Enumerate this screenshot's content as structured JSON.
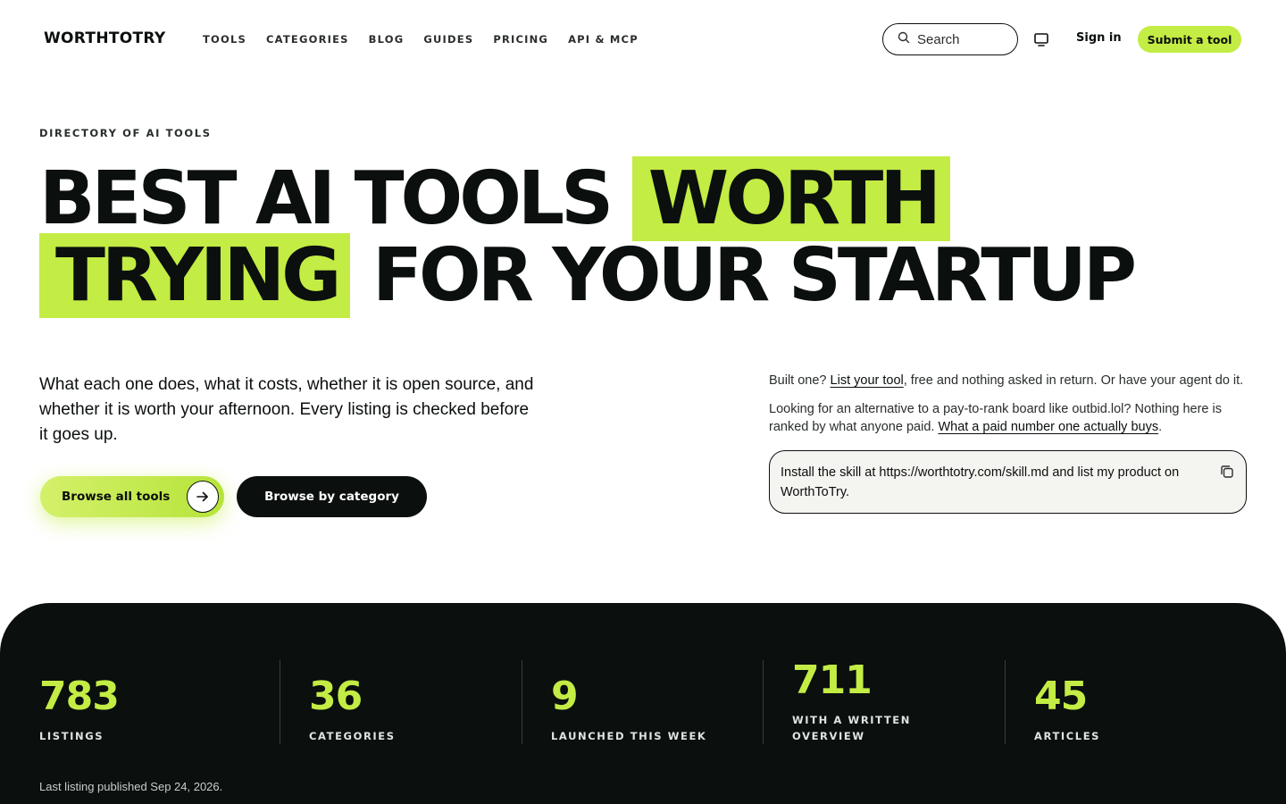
{
  "nav": {
    "logo": "WORTHTOTRY",
    "links": [
      "TOOLS",
      "CATEGORIES",
      "BLOG",
      "GUIDES",
      "PRICING",
      "API & MCP"
    ],
    "search_placeholder": "Search",
    "signin": "Sign in",
    "submit": "Submit a tool"
  },
  "hero": {
    "eyebrow": "DIRECTORY OF AI TOOLS",
    "headline": {
      "line1_plain": "BEST AI TOOLS ",
      "line1_highlight": "WORTH",
      "line2_highlight": "TRYING",
      "line2_plain": " FOR YOUR STARTUP"
    },
    "lede": "What each one does, what it costs, whether it is open source, and whether it is worth your afternoon. Every listing is checked before it goes up.",
    "browse_all": "Browse all tools",
    "browse_category": "Browse by category"
  },
  "side": {
    "p1_before": "Built one? ",
    "p1_link": "List your tool",
    "p1_after": ", free and nothing asked in return. Or have your agent do it.",
    "p2_before": "Looking for an alternative to a pay-to-rank board like outbid.lol? Nothing here is ranked by what anyone paid. ",
    "p2_link": "What a paid number one actually buys",
    "p2_after": ".",
    "prompt": "Install the skill at https://worthtotry.com/skill.md and list my product on WorthToTry."
  },
  "stats": {
    "items": [
      {
        "value": "783",
        "label": "LISTINGS"
      },
      {
        "value": "36",
        "label": "CATEGORIES"
      },
      {
        "value": "9",
        "label": "LAUNCHED THIS WEEK"
      },
      {
        "value": "711",
        "label_line1": "WITH A WRITTEN",
        "label_line2": "OVERVIEW"
      },
      {
        "value": "45",
        "label": "ARTICLES"
      }
    ],
    "last_published": "Last listing published Sep 24, 2026."
  },
  "colors": {
    "accent": "#c3ec44",
    "ink": "#0b0f0e",
    "panel": "#f4f4f0"
  }
}
